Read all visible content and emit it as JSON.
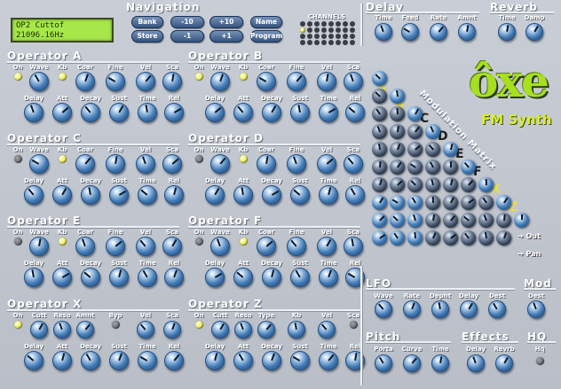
{
  "lcd": {
    "line1": "OP2 Cuttof",
    "line2": "21096.16Hz"
  },
  "navigation": {
    "title": "Navigation",
    "buttons": [
      {
        "id": "bank",
        "label": "Bank"
      },
      {
        "id": "m10",
        "label": "-10"
      },
      {
        "id": "p10",
        "label": "+10"
      },
      {
        "id": "name",
        "label": "Name"
      },
      {
        "id": "store",
        "label": "Store"
      },
      {
        "id": "m1",
        "label": "-1"
      },
      {
        "id": "p1",
        "label": "+1"
      },
      {
        "id": "program",
        "label": "Program"
      }
    ],
    "channels_label": "CHANNELS"
  },
  "delay": {
    "title": "Delay",
    "labels": [
      "Time",
      "Feed",
      "Rate",
      "Amnt"
    ]
  },
  "reverb": {
    "title": "Reverb",
    "labels": [
      "Time",
      "Damp"
    ]
  },
  "op_labels_top": [
    "On",
    "Wave",
    "Kb",
    "Coar",
    "Fine",
    "Vel",
    "Sca"
  ],
  "op_labels_bottom": [
    "Delay",
    "Att",
    "Decay",
    "Sust",
    "Time",
    "Rel"
  ],
  "opx_labels_top": [
    "On",
    "Cutt",
    "Reso",
    "Amnt",
    "Byp",
    "Vel",
    "Sca"
  ],
  "opz_labels_top": [
    "On",
    "Cutt",
    "Reso",
    "Type",
    "Kb",
    "Vel",
    "Sca"
  ],
  "operators": [
    {
      "id": "a",
      "title": "Operator A",
      "on": true,
      "kb": true
    },
    {
      "id": "b",
      "title": "Operator B",
      "on": true,
      "kb": true
    },
    {
      "id": "c",
      "title": "Operator C",
      "on": false,
      "kb": true
    },
    {
      "id": "d",
      "title": "Operator D",
      "on": false,
      "kb": true
    },
    {
      "id": "e",
      "title": "Operator E",
      "on": false,
      "kb": true
    },
    {
      "id": "f",
      "title": "Operator F",
      "on": false,
      "kb": true
    },
    {
      "id": "x",
      "title": "Operator X",
      "on": true,
      "kb": false
    },
    {
      "id": "z",
      "title": "Operator Z",
      "on": true,
      "kb": false
    }
  ],
  "logo": {
    "text": "ôxe",
    "subtitle": "FM Synth"
  },
  "matrix": {
    "title": "Modulation Matrix",
    "row_labels": [
      "A",
      "B",
      "C",
      "D",
      "E",
      "F",
      "X",
      "Z"
    ],
    "out_label": "Out",
    "pan_label": "Pan"
  },
  "lfo": {
    "title": "LFO",
    "labels": [
      "Wave",
      "Rate",
      "Depht",
      "Delay",
      "Dest"
    ]
  },
  "mod": {
    "title": "Mod",
    "labels": [
      "Dest"
    ]
  },
  "pitch": {
    "title": "Pitch",
    "labels": [
      "Porta",
      "Curve",
      "Time"
    ]
  },
  "effects": {
    "title": "Effects",
    "labels": [
      "Delay",
      "Revrb"
    ]
  },
  "hq": {
    "title": "HQ",
    "labels": [
      "Hq"
    ]
  },
  "colors": {
    "background": "#c2c7cf",
    "title": "#ffffff",
    "lcd": "#a6e84a",
    "logo_green": "#a6e01e",
    "led_on": "#e8ea4a"
  }
}
